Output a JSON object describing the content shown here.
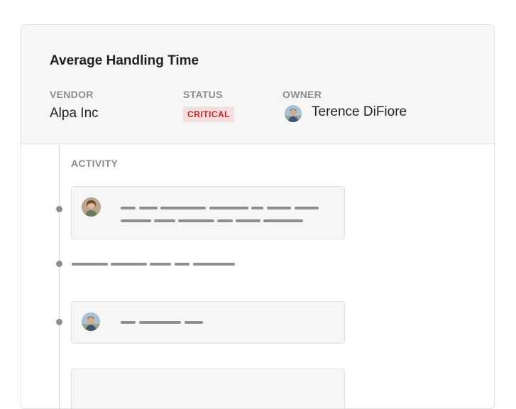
{
  "header": {
    "title": "Average Handling Time",
    "vendor_label": "VENDOR",
    "vendor_value": "Alpa Inc",
    "status_label": "STATUS",
    "status_value": "CRITICAL",
    "owner_label": "OWNER",
    "owner_name": "Terence DiFiore"
  },
  "activity": {
    "label": "ACTIVITY",
    "entries": [
      {
        "kind": "comment",
        "avatar": "avatar-woman"
      },
      {
        "kind": "event"
      },
      {
        "kind": "comment",
        "avatar": "avatar-man"
      },
      {
        "kind": "comment"
      }
    ]
  },
  "colors": {
    "status_bg": "#f4dede",
    "status_text": "#c0282a",
    "placeholder": "#8e8e8e",
    "header_bg": "#f6f6f6"
  }
}
